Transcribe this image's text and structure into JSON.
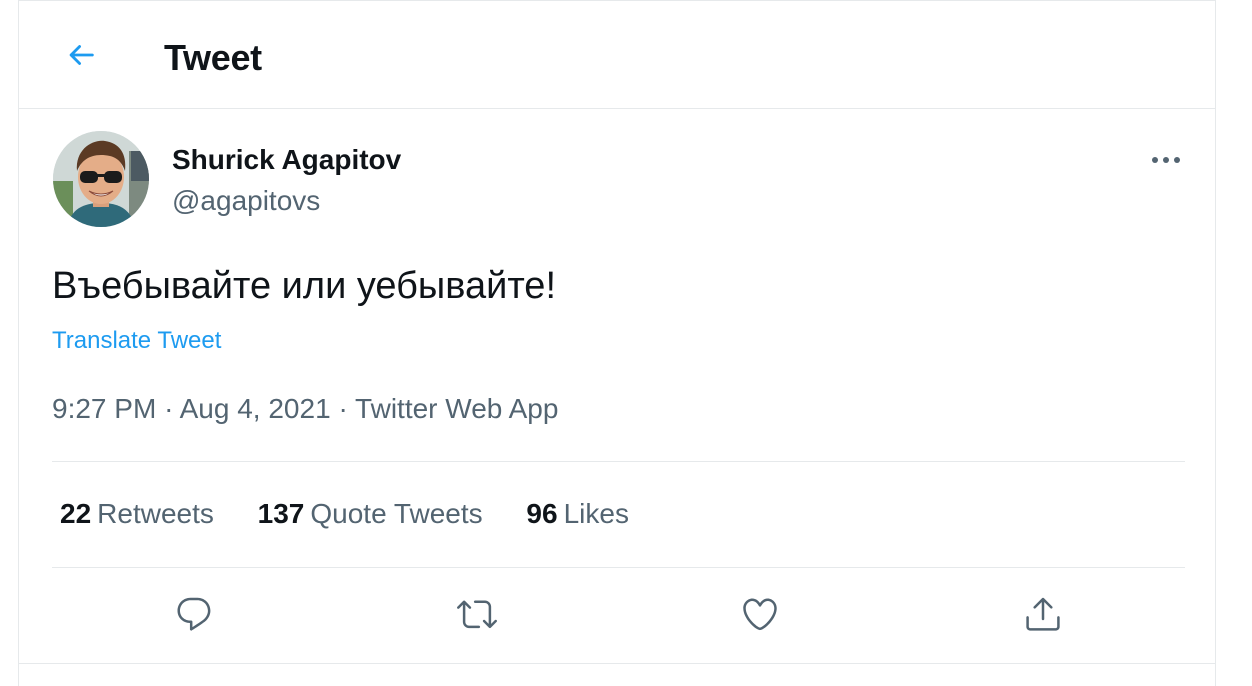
{
  "header": {
    "title": "Tweet",
    "back_icon": "arrow-left-icon",
    "accent_color": "#1d9bf0"
  },
  "author": {
    "display_name": "Shurick Agapitov",
    "handle": "@agapitovs",
    "avatar": "avatar-photo"
  },
  "tweet": {
    "text": "Въебывайте или уебывайте!",
    "translate_label": "Translate Tweet",
    "time": "9:27 PM",
    "date": "Aug 4, 2021",
    "source": "Twitter Web App",
    "separator": "·"
  },
  "stats": [
    {
      "count": "22",
      "label": "Retweets"
    },
    {
      "count": "137",
      "label": "Quote Tweets"
    },
    {
      "count": "96",
      "label": "Likes"
    }
  ],
  "actions": [
    {
      "name": "reply",
      "icon": "reply-icon"
    },
    {
      "name": "retweet",
      "icon": "retweet-icon"
    },
    {
      "name": "like",
      "icon": "heart-icon"
    },
    {
      "name": "share",
      "icon": "share-icon"
    }
  ],
  "colors": {
    "text_primary": "#0f1419",
    "text_secondary": "#536471",
    "link": "#1d9bf0",
    "border": "#e6e9eb"
  }
}
